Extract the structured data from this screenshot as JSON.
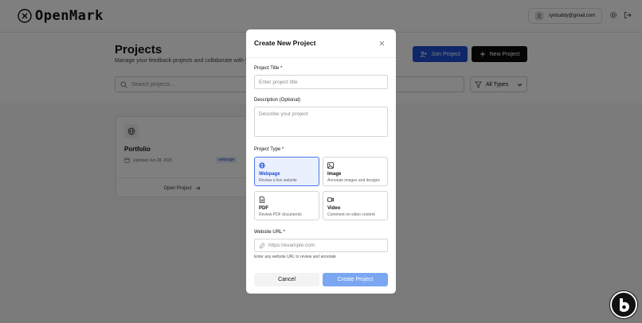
{
  "header": {
    "logo_text": "OpenMark",
    "user_email": "rynbuddy@gmail.com",
    "icons": {
      "avatar": "user-icon",
      "settings": "gear-icon",
      "logout": "logout-icon"
    }
  },
  "page": {
    "title": "Projects",
    "subtitle": "Manage your feedback projects and collaborate with y",
    "join_button": "Join Project",
    "new_button": "New Project",
    "search_placeholder": "Search projects...",
    "filter_selected": "All Types"
  },
  "project_card": {
    "title": "Portfolio",
    "updated": "Updated Jun 28, 2025",
    "badge": "webpage",
    "open_label": "Open Project"
  },
  "modal": {
    "title": "Create New Project",
    "title_label": "Project Title *",
    "title_placeholder": "Enter project title",
    "desc_label": "Description (Optional)",
    "desc_placeholder": "Describe your project",
    "type_label": "Project Type *",
    "types": [
      {
        "name": "Webpage",
        "desc": "Review a live website",
        "icon": "globe-icon",
        "selected": true
      },
      {
        "name": "Image",
        "desc": "Annotate images and designs",
        "icon": "image-icon",
        "selected": false
      },
      {
        "name": "PDF",
        "desc": "Review PDF documents",
        "icon": "document-icon",
        "selected": false
      },
      {
        "name": "Video",
        "desc": "Comment on video content",
        "icon": "video-icon",
        "selected": false
      }
    ],
    "url_label": "Website URL *",
    "url_placeholder": "https://example.com",
    "url_hint": "Enter any website URL to review and annotate",
    "cancel": "Cancel",
    "create": "Create Project"
  },
  "colors": {
    "primary": "#1f4fd1",
    "create_disabled": "#7ba7f2",
    "selected_bg": "#eaf0fd"
  }
}
